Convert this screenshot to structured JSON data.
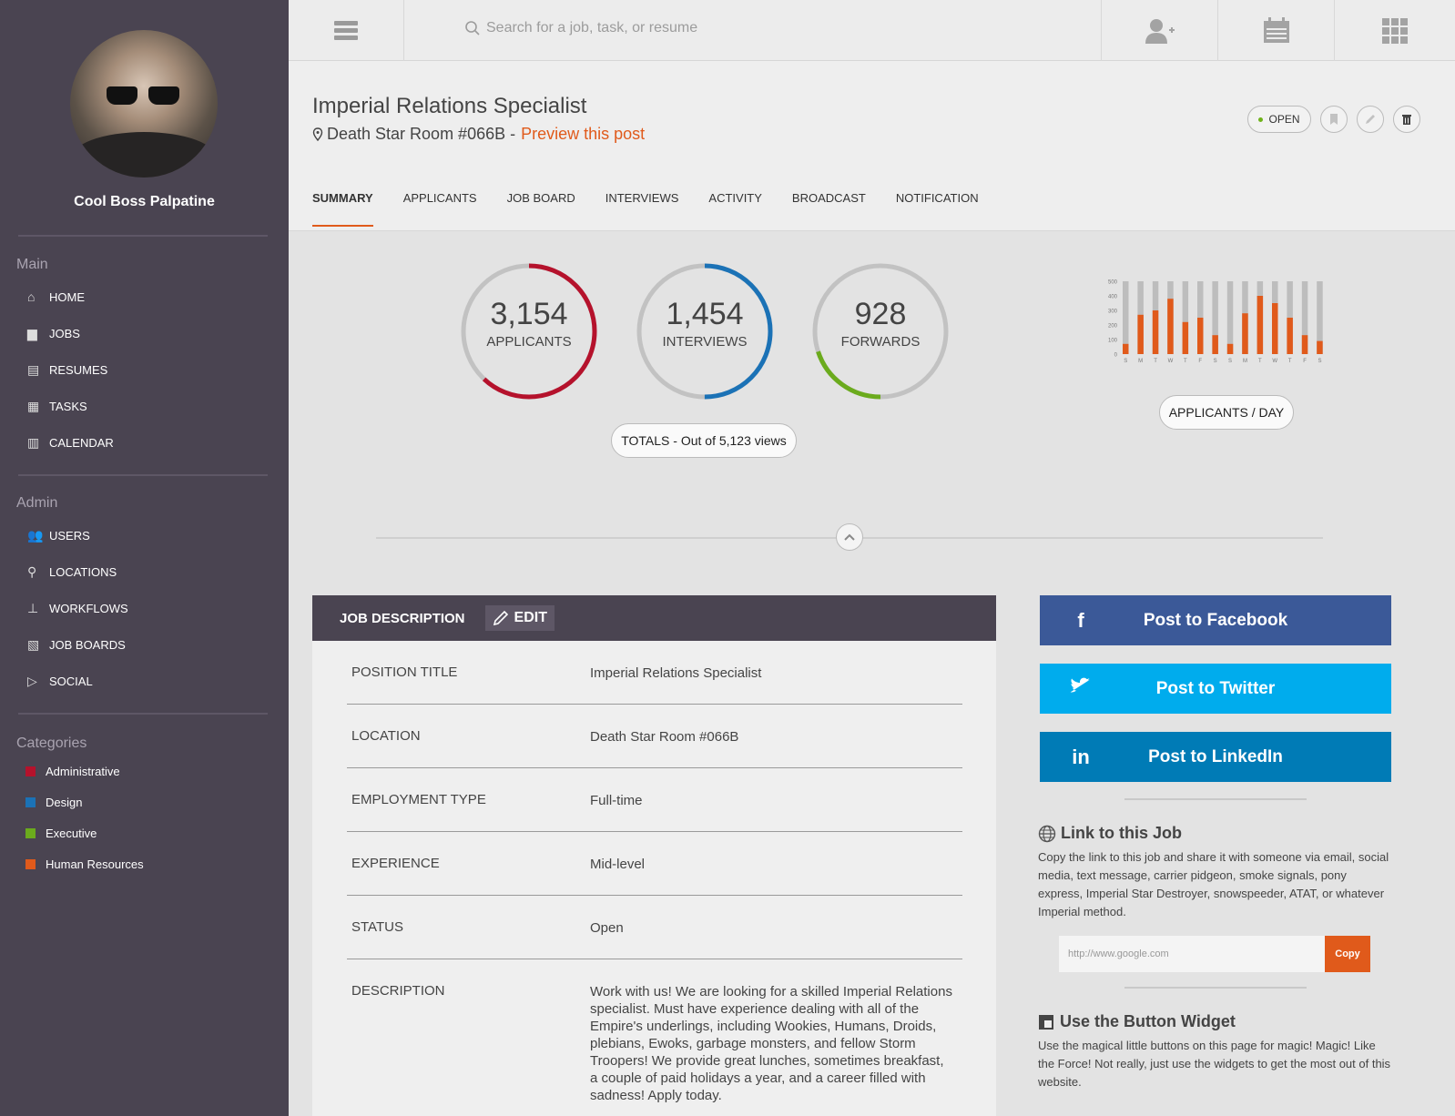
{
  "user": {
    "name": "Cool Boss Palpatine"
  },
  "sidebar": {
    "main_heading": "Main",
    "main_items": [
      {
        "label": "HOME",
        "icon": "home-icon"
      },
      {
        "label": "JOBS",
        "icon": "briefcase-icon"
      },
      {
        "label": "RESUMES",
        "icon": "document-icon"
      },
      {
        "label": "TASKS",
        "icon": "tasks-icon"
      },
      {
        "label": "CALENDAR",
        "icon": "calendar-icon"
      }
    ],
    "admin_heading": "Admin",
    "admin_items": [
      {
        "label": "USERS",
        "icon": "users-icon"
      },
      {
        "label": "LOCATIONS",
        "icon": "location-pin-icon"
      },
      {
        "label": "WORKFLOWS",
        "icon": "workflow-icon"
      },
      {
        "label": "JOB BOARDS",
        "icon": "job-boards-icon"
      },
      {
        "label": "SOCIAL",
        "icon": "social-icon"
      }
    ],
    "categories_heading": "Categories",
    "categories": [
      {
        "label": "Administrative",
        "color": "#b5122c"
      },
      {
        "label": "Design",
        "color": "#1b72b6"
      },
      {
        "label": "Executive",
        "color": "#6bab1d"
      },
      {
        "label": "Human Resources",
        "color": "#e05a1b"
      }
    ]
  },
  "topbar": {
    "search_placeholder": "Search for a job, task, or resume"
  },
  "job": {
    "title": "Imperial Relations Specialist",
    "location": "Death Star Room #066B -",
    "preview_link": "Preview this post",
    "status": "OPEN"
  },
  "tabs": [
    "SUMMARY",
    "APPLICANTS",
    "JOB BOARD",
    "INTERVIEWS",
    "ACTIVITY",
    "BROADCAST",
    "NOTIFICATION"
  ],
  "stats": {
    "applicants": {
      "value": "3,154",
      "label": "APPLICANTS",
      "color": "#b5122c",
      "fraction": 0.62
    },
    "interviews": {
      "value": "1,454",
      "label": "INTERVIEWS",
      "color": "#1b72b6",
      "fraction": 0.5
    },
    "forwards": {
      "value": "928",
      "label": "FORWARDS",
      "color": "#6bab1d",
      "fraction": 0.2
    },
    "totals_label": "TOTALS - Out of 5,123 views",
    "chart_label": "APPLICANTS / DAY"
  },
  "chart_data": {
    "type": "bar",
    "categories": [
      "S",
      "M",
      "T",
      "W",
      "T",
      "F",
      "S",
      "S",
      "M",
      "T",
      "W",
      "T",
      "F",
      "S"
    ],
    "values": [
      70,
      270,
      300,
      380,
      220,
      250,
      130,
      70,
      280,
      400,
      350,
      250,
      130,
      90
    ],
    "totals": [
      500,
      500,
      500,
      500,
      500,
      500,
      500,
      500,
      500,
      500,
      500,
      500,
      500,
      500
    ],
    "yticks": [
      "500",
      "400",
      "300",
      "200",
      "100",
      "0"
    ],
    "ylim": [
      0,
      500
    ],
    "colors": {
      "value": "#e05a1b",
      "total": "#bdbdbd"
    }
  },
  "job_description": {
    "heading": "JOB DESCRIPTION",
    "edit_label": "EDIT",
    "rows": [
      {
        "key": "POSITION TITLE",
        "value": "Imperial Relations Specialist"
      },
      {
        "key": "LOCATION",
        "value": "Death Star Room #066B"
      },
      {
        "key": "EMPLOYMENT TYPE",
        "value": "Full-time"
      },
      {
        "key": "EXPERIENCE",
        "value": "Mid-level"
      },
      {
        "key": "STATUS",
        "value": "Open"
      },
      {
        "key": "DESCRIPTION",
        "value": "Work with us! We are looking for a skilled Imperial Relations specialist. Must have experience dealing with all of the Empire's underlings, including Wookies, Humans, Droids, plebians, Ewoks, garbage monsters, and fellow Storm Troopers! We provide great lunches, sometimes breakfast, a couple of paid holidays a year, and a career filled with sadness! Apply today."
      }
    ]
  },
  "social": {
    "facebook": {
      "label": "Post to Facebook",
      "icon_text": "f",
      "color": "#3b5998"
    },
    "twitter": {
      "label": "Post to Twitter",
      "color": "#00aced"
    },
    "linkedin": {
      "label": "Post to LinkedIn",
      "icon_text": "in",
      "color": "#007bb6"
    }
  },
  "link_section": {
    "title": "Link to this Job",
    "text": "Copy the link to this job and share it with someone via email, social media, text message, carrier pidgeon, smoke signals, pony express, Imperial Star Destroyer, snowspeeder, ATAT, or whatever Imperial method.",
    "url_value": "http://www.google.com",
    "copy_label": "Copy"
  },
  "widget_section": {
    "title": "Use the Button Widget",
    "text": "Use the magical little buttons on this page for magic! Magic! Like the Force! Not really, just use the widgets to get the most out of this website."
  }
}
